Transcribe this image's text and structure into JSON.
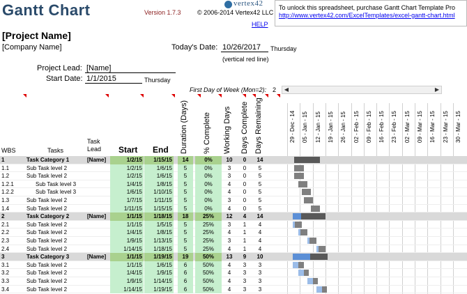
{
  "header": {
    "title": "Gantt Chart",
    "version": "Version 1.7.3",
    "copyright": "© 2006-2014 Vertex42 LLC",
    "logo_text": "vertex42",
    "help_label": "HELP",
    "notice_text": "To unlock this spreadsheet, purchase Gantt Chart Template Pro",
    "notice_link": "http://www.vertex42.com/ExcelTemplates/excel-gantt-chart.html"
  },
  "project": {
    "name": "[Project Name]",
    "company": "[Company Name]",
    "todays_date_label": "Today's Date:",
    "todays_date": "10/26/2017",
    "todays_day": "Thursday",
    "red_line_note": "(vertical red line)",
    "lead_label": "Project Lead:",
    "lead_value": "[Name]",
    "start_label": "Start Date:",
    "start_value": "1/1/2015",
    "start_day": "Thursday",
    "first_day_label": "First Day of Week (Mon=2):",
    "first_day_value": "2"
  },
  "columns": {
    "wbs": "WBS",
    "tasks": "Tasks",
    "task_lead": "Task Lead",
    "start": "Start",
    "end": "End",
    "duration": "Duration (Days)",
    "pct": "% Complete",
    "working": "Working Days",
    "done": "Days Complete",
    "remain": "Days Remaining"
  },
  "week_headers": [
    "29 - Dec - 14",
    "05 - Jan - 15",
    "12 - Jan - 15",
    "19 - Jan - 15",
    "26 - Jan - 15",
    "02 - Feb - 15",
    "09 - Feb - 15",
    "16 - Feb - 15",
    "23 - Feb - 15",
    "02 - Mar - 15",
    "09 - Mar - 15",
    "16 - Mar - 15",
    "23 - Mar - 15",
    "30 - Mar - 15"
  ],
  "rows": [
    {
      "wbs": "1",
      "task": "Task Category 1",
      "lead": "[Name]",
      "start": "1/2/15",
      "end": "1/15/15",
      "dur": "14",
      "pct": "0%",
      "work": "10",
      "done": "0",
      "rem": "14",
      "cat": true,
      "pct_num": 0
    },
    {
      "wbs": "1.1",
      "task": "Sub Task level 2",
      "lead": "",
      "start": "1/2/15",
      "end": "1/6/15",
      "dur": "5",
      "pct": "0%",
      "work": "3",
      "done": "0",
      "rem": "5",
      "level": 2,
      "pct_num": 0
    },
    {
      "wbs": "1.2",
      "task": "Sub Task level 2",
      "lead": "",
      "start": "1/2/15",
      "end": "1/6/15",
      "dur": "5",
      "pct": "0%",
      "work": "3",
      "done": "0",
      "rem": "5",
      "level": 2,
      "pct_num": 0
    },
    {
      "wbs": "1.2.1",
      "task": "Sub Task level 3",
      "lead": "",
      "start": "1/4/15",
      "end": "1/8/15",
      "dur": "5",
      "pct": "0%",
      "work": "4",
      "done": "0",
      "rem": "5",
      "level": 3,
      "pct_num": 0
    },
    {
      "wbs": "1.2.2",
      "task": "Sub Task level 3",
      "lead": "",
      "start": "1/6/15",
      "end": "1/10/15",
      "dur": "5",
      "pct": "0%",
      "work": "4",
      "done": "0",
      "rem": "5",
      "level": 3,
      "pct_num": 0
    },
    {
      "wbs": "1.3",
      "task": "Sub Task level 2",
      "lead": "",
      "start": "1/7/15",
      "end": "1/11/15",
      "dur": "5",
      "pct": "0%",
      "work": "3",
      "done": "0",
      "rem": "5",
      "level": 2,
      "pct_num": 0
    },
    {
      "wbs": "1.4",
      "task": "Sub Task level 2",
      "lead": "",
      "start": "1/11/15",
      "end": "1/15/15",
      "dur": "5",
      "pct": "0%",
      "work": "4",
      "done": "0",
      "rem": "5",
      "level": 2,
      "pct_num": 0
    },
    {
      "wbs": "2",
      "task": "Task Category 2",
      "lead": "[Name]",
      "start": "1/1/15",
      "end": "1/18/15",
      "dur": "18",
      "pct": "25%",
      "work": "12",
      "done": "4",
      "rem": "14",
      "cat": true,
      "pct_num": 25
    },
    {
      "wbs": "2.1",
      "task": "Sub Task level 2",
      "lead": "",
      "start": "1/1/15",
      "end": "1/5/15",
      "dur": "5",
      "pct": "25%",
      "work": "3",
      "done": "1",
      "rem": "4",
      "level": 2,
      "pct_num": 25
    },
    {
      "wbs": "2.2",
      "task": "Sub Task level 2",
      "lead": "",
      "start": "1/4/15",
      "end": "1/8/15",
      "dur": "5",
      "pct": "25%",
      "work": "4",
      "done": "1",
      "rem": "4",
      "level": 2,
      "pct_num": 25
    },
    {
      "wbs": "2.3",
      "task": "Sub Task level 2",
      "lead": "",
      "start": "1/9/15",
      "end": "1/13/15",
      "dur": "5",
      "pct": "25%",
      "work": "3",
      "done": "1",
      "rem": "4",
      "level": 2,
      "pct_num": 25
    },
    {
      "wbs": "2.4",
      "task": "Sub Task level 2",
      "lead": "",
      "start": "1/14/15",
      "end": "1/18/15",
      "dur": "5",
      "pct": "25%",
      "work": "4",
      "done": "1",
      "rem": "4",
      "level": 2,
      "pct_num": 25
    },
    {
      "wbs": "3",
      "task": "Task Category 3",
      "lead": "[Name]",
      "start": "1/1/15",
      "end": "1/19/15",
      "dur": "19",
      "pct": "50%",
      "work": "13",
      "done": "9",
      "rem": "10",
      "cat": true,
      "pct_num": 50
    },
    {
      "wbs": "3.1",
      "task": "Sub Task level 2",
      "lead": "",
      "start": "1/1/15",
      "end": "1/6/15",
      "dur": "6",
      "pct": "50%",
      "work": "4",
      "done": "3",
      "rem": "3",
      "level": 2,
      "pct_num": 50
    },
    {
      "wbs": "3.2",
      "task": "Sub Task level 2",
      "lead": "",
      "start": "1/4/15",
      "end": "1/9/15",
      "dur": "6",
      "pct": "50%",
      "work": "4",
      "done": "3",
      "rem": "3",
      "level": 2,
      "pct_num": 50
    },
    {
      "wbs": "3.3",
      "task": "Sub Task level 2",
      "lead": "",
      "start": "1/9/15",
      "end": "1/14/15",
      "dur": "6",
      "pct": "50%",
      "work": "4",
      "done": "3",
      "rem": "3",
      "level": 2,
      "pct_num": 50
    },
    {
      "wbs": "3.4",
      "task": "Sub Task level 2",
      "lead": "",
      "start": "1/14/15",
      "end": "1/19/15",
      "dur": "6",
      "pct": "50%",
      "work": "4",
      "done": "3",
      "rem": "3",
      "level": 2,
      "pct_num": 50
    }
  ],
  "colors": {
    "cat_row": "#d9d9d9",
    "date_fill": "#c6efce",
    "pct_fill": "#c6efce",
    "bar_done": "#5b8fd6",
    "bar_remaining": "#595959",
    "bar_sub_done": "#9bbce8",
    "bar_sub_remaining": "#7f7f7f"
  }
}
